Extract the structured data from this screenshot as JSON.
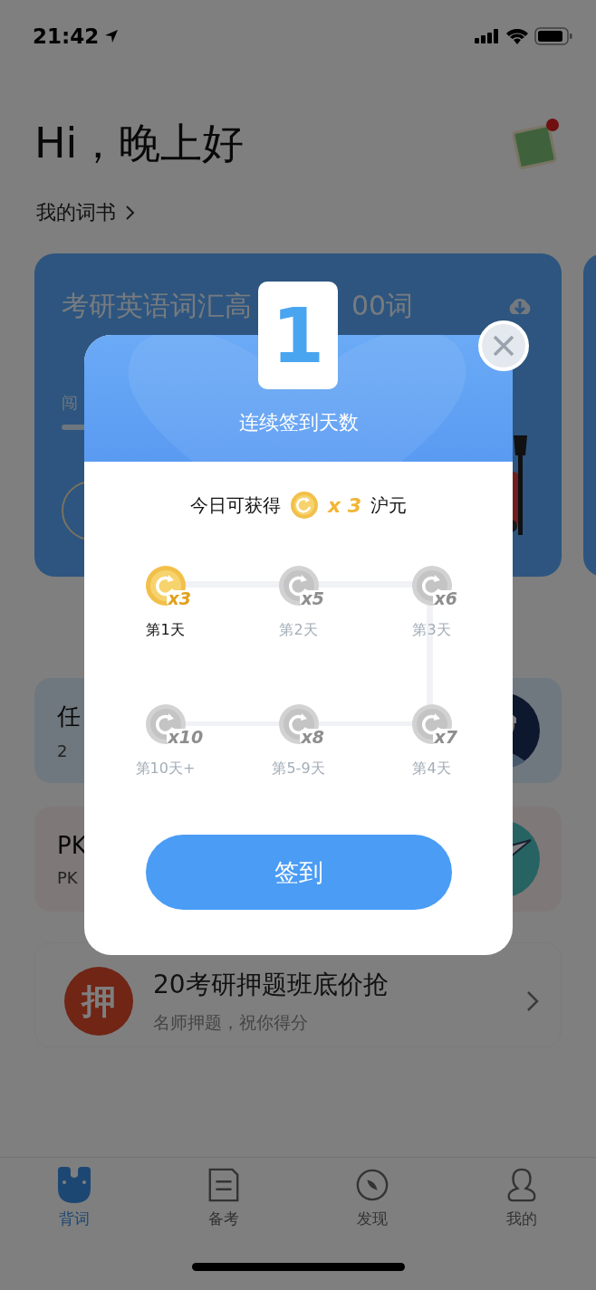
{
  "status_bar": {
    "time": "21:42"
  },
  "greeting": "Hi，晚上好",
  "my_books_link": "我的词书",
  "book_card": {
    "title_parts": [
      "考研英语词汇高",
      "00词"
    ],
    "progress_label": "闯"
  },
  "cards": [
    {
      "kind": "task",
      "title": "任",
      "subtitle": "2"
    },
    {
      "kind": "pk",
      "title": "PK",
      "subtitle": "PK"
    }
  ],
  "promo": {
    "badge": "押",
    "title": "20考研押题班底价抢",
    "subtitle": "名师押题，祝你得分"
  },
  "tabs": [
    {
      "label": "背词",
      "selected": true
    },
    {
      "label": "备考",
      "selected": false
    },
    {
      "label": "发现",
      "selected": false
    },
    {
      "label": "我的",
      "selected": false
    }
  ],
  "modal": {
    "streak_days": "1",
    "title": "连续签到天数",
    "reward_prefix": "今日可获得",
    "reward_multiplier": "x 3",
    "reward_unit": "沪元",
    "days": [
      {
        "label": "第1天",
        "multiplier": "x3",
        "checked": true
      },
      {
        "label": "第2天",
        "multiplier": "x5",
        "checked": false
      },
      {
        "label": "第3天",
        "multiplier": "x6",
        "checked": false
      },
      {
        "label": "第10天+",
        "multiplier": "x10",
        "checked": false
      },
      {
        "label": "第5-9天",
        "multiplier": "x8",
        "checked": false
      },
      {
        "label": "第4天",
        "multiplier": "x7",
        "checked": false
      }
    ],
    "button": "签到"
  }
}
